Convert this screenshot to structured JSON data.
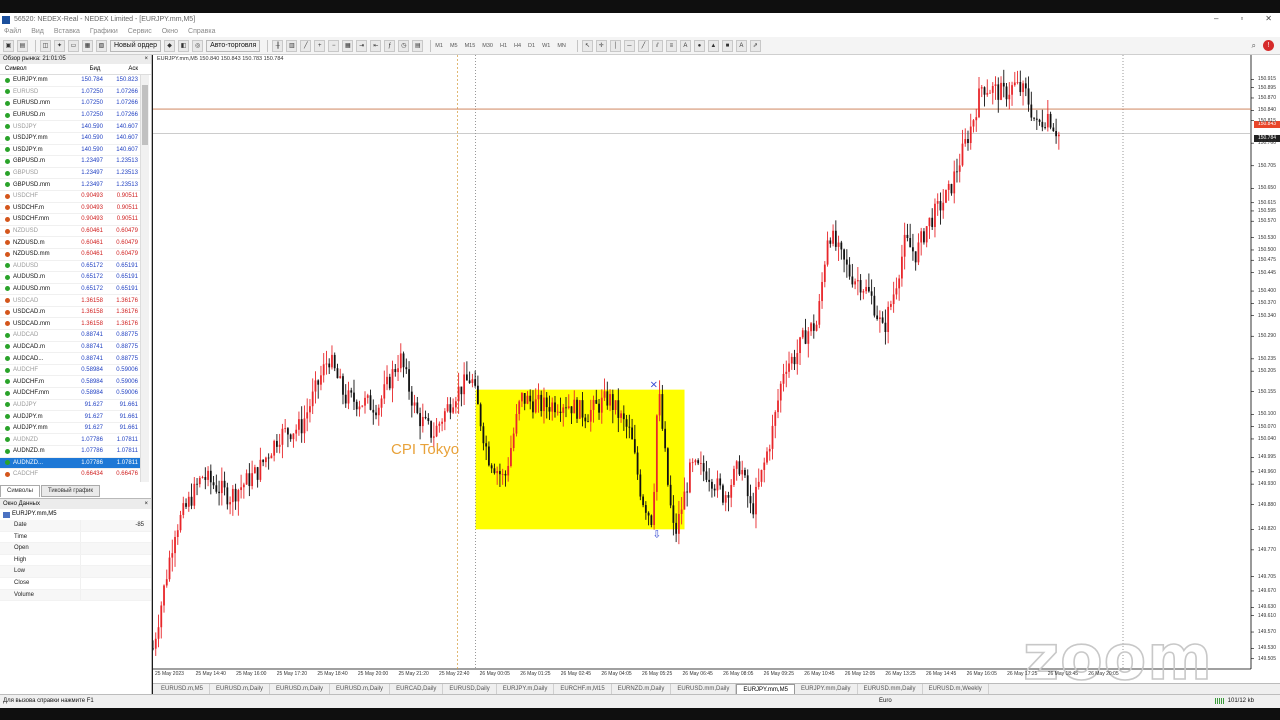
{
  "window": {
    "title": "56520: NEDEX-Real - NEDEX Limited - [EURJPY.mm,M5]",
    "controls": [
      "–",
      "▫",
      "✕"
    ]
  },
  "menu": {
    "items": [
      "Файл",
      "Вид",
      "Вставка",
      "Графики",
      "Сервис",
      "Окно",
      "Справка"
    ]
  },
  "toolbar": {
    "new_order": "Новый ордер",
    "auto_trading": "Авто-торговля",
    "timeframes": [
      "M1",
      "M5",
      "M15",
      "M30",
      "H1",
      "H4",
      "D1",
      "W1",
      "MN"
    ]
  },
  "market_watch": {
    "title": "Обзор рынка: 21:01:05",
    "col_symbol": "Символ",
    "col_bid": "Бид",
    "col_ask": "Аск",
    "rows": [
      {
        "sym": "EURJPY.mm",
        "bid": "150.784",
        "ask": "150.823",
        "dim": false,
        "red": false
      },
      {
        "sym": "EURUSD",
        "bid": "1.07250",
        "ask": "1.07266",
        "dim": true,
        "red": false
      },
      {
        "sym": "EURUSD.mm",
        "bid": "1.07250",
        "ask": "1.07266",
        "dim": false,
        "red": false
      },
      {
        "sym": "EURUSD.m",
        "bid": "1.07250",
        "ask": "1.07266",
        "dim": false,
        "red": false
      },
      {
        "sym": "USDJPY",
        "bid": "140.590",
        "ask": "140.607",
        "dim": true,
        "red": false
      },
      {
        "sym": "USDJPY.mm",
        "bid": "140.590",
        "ask": "140.607",
        "dim": false,
        "red": false
      },
      {
        "sym": "USDJPY.m",
        "bid": "140.590",
        "ask": "140.607",
        "dim": false,
        "red": false
      },
      {
        "sym": "GBPUSD.m",
        "bid": "1.23497",
        "ask": "1.23513",
        "dim": false,
        "red": false
      },
      {
        "sym": "GBPUSD",
        "bid": "1.23497",
        "ask": "1.23513",
        "dim": true,
        "red": false
      },
      {
        "sym": "GBPUSD.mm",
        "bid": "1.23497",
        "ask": "1.23513",
        "dim": false,
        "red": false
      },
      {
        "sym": "USDCHF",
        "bid": "0.90493",
        "ask": "0.90511",
        "dim": true,
        "red": true
      },
      {
        "sym": "USDCHF.m",
        "bid": "0.90493",
        "ask": "0.90511",
        "dim": false,
        "red": true
      },
      {
        "sym": "USDCHF.mm",
        "bid": "0.90493",
        "ask": "0.90511",
        "dim": false,
        "red": true
      },
      {
        "sym": "NZDUSD",
        "bid": "0.60461",
        "ask": "0.60479",
        "dim": true,
        "red": true
      },
      {
        "sym": "NZDUSD.m",
        "bid": "0.60461",
        "ask": "0.60479",
        "dim": false,
        "red": true
      },
      {
        "sym": "NZDUSD.mm",
        "bid": "0.60461",
        "ask": "0.60479",
        "dim": false,
        "red": true
      },
      {
        "sym": "AUDUSD",
        "bid": "0.65172",
        "ask": "0.65191",
        "dim": true,
        "red": false
      },
      {
        "sym": "AUDUSD.m",
        "bid": "0.65172",
        "ask": "0.65191",
        "dim": false,
        "red": false
      },
      {
        "sym": "AUDUSD.mm",
        "bid": "0.65172",
        "ask": "0.65191",
        "dim": false,
        "red": false
      },
      {
        "sym": "USDCAD",
        "bid": "1.36158",
        "ask": "1.36176",
        "dim": true,
        "red": true
      },
      {
        "sym": "USDCAD.m",
        "bid": "1.36158",
        "ask": "1.36176",
        "dim": false,
        "red": true
      },
      {
        "sym": "USDCAD.mm",
        "bid": "1.36158",
        "ask": "1.36176",
        "dim": false,
        "red": true
      },
      {
        "sym": "AUDCAD",
        "bid": "0.88741",
        "ask": "0.88775",
        "dim": true,
        "red": false
      },
      {
        "sym": "AUDCAD.m",
        "bid": "0.88741",
        "ask": "0.88775",
        "dim": false,
        "red": false
      },
      {
        "sym": "AUDCAD...",
        "bid": "0.88741",
        "ask": "0.88775",
        "dim": false,
        "red": false
      },
      {
        "sym": "AUDCHF",
        "bid": "0.58984",
        "ask": "0.59006",
        "dim": true,
        "red": false
      },
      {
        "sym": "AUDCHF.m",
        "bid": "0.58984",
        "ask": "0.59006",
        "dim": false,
        "red": false
      },
      {
        "sym": "AUDCHF.mm",
        "bid": "0.58984",
        "ask": "0.59006",
        "dim": false,
        "red": false
      },
      {
        "sym": "AUDJPY",
        "bid": "91.627",
        "ask": "91.661",
        "dim": true,
        "red": false
      },
      {
        "sym": "AUDJPY.m",
        "bid": "91.627",
        "ask": "91.661",
        "dim": false,
        "red": false
      },
      {
        "sym": "AUDJPY.mm",
        "bid": "91.627",
        "ask": "91.661",
        "dim": false,
        "red": false
      },
      {
        "sym": "AUDNZD",
        "bid": "1.07786",
        "ask": "1.07811",
        "dim": true,
        "red": false
      },
      {
        "sym": "AUDNZD.m",
        "bid": "1.07786",
        "ask": "1.07811",
        "dim": false,
        "red": false
      },
      {
        "sym": "AUDNZD...",
        "bid": "1.07786",
        "ask": "1.07811",
        "dim": false,
        "red": false,
        "selected": true
      },
      {
        "sym": "CADCHF",
        "bid": "0.66434",
        "ask": "0.66476",
        "dim": true,
        "red": true
      }
    ],
    "tabs": [
      "Символы",
      "Тиковый график"
    ]
  },
  "data_window": {
    "title": "Окно Данных",
    "symbol": "EURJPY.mm,M5",
    "rows": [
      {
        "label": "Date",
        "value": "-85"
      },
      {
        "label": "Time",
        "value": ""
      },
      {
        "label": "Open",
        "value": ""
      },
      {
        "label": "High",
        "value": ""
      },
      {
        "label": "Low",
        "value": ""
      },
      {
        "label": "Close",
        "value": ""
      },
      {
        "label": "Volume",
        "value": ""
      }
    ]
  },
  "chart": {
    "legend": "EURJPY.mm,M5  150.840 150.843 150.783 150.784",
    "annotation": "CPI Tokyo",
    "watermark": "zoom",
    "current_bid_tag": "150.843",
    "current_price_tag": "150.784",
    "colors": {
      "up": "#e8262a",
      "down": "#111111",
      "box": "#ffff00",
      "annotation": "#e8a23a"
    }
  },
  "chart_data": {
    "type": "candlestick",
    "title": "",
    "symbol": "EURJPY.mm",
    "timeframe": "M5",
    "y_ticks": [
      "150.915",
      "150.895",
      "150.870",
      "150.840",
      "150.815",
      "150.760",
      "150.705",
      "150.650",
      "150.615",
      "150.595",
      "150.570",
      "150.530",
      "150.500",
      "150.475",
      "150.445",
      "150.400",
      "150.370",
      "150.340",
      "150.290",
      "150.235",
      "150.205",
      "150.155",
      "150.100",
      "150.070",
      "150.040",
      "149.995",
      "149.960",
      "149.930",
      "149.880",
      "149.820",
      "149.770",
      "149.705",
      "149.670",
      "149.630",
      "149.610",
      "149.570",
      "149.530",
      "149.505"
    ],
    "x_ticks": [
      "25 May 2023",
      "25 May 14:40",
      "25 May 16:00",
      "25 May 17:20",
      "25 May 18:40",
      "25 May 20:00",
      "25 May 21:20",
      "25 May 22:40",
      "26 May 00:05",
      "26 May 01:25",
      "26 May 02:45",
      "26 May 04:05",
      "26 May 05:25",
      "26 May 06:45",
      "26 May 08:05",
      "26 May 09:25",
      "26 May 10:45",
      "26 May 12:05",
      "26 May 13:25",
      "26 May 14:45",
      "26 May 16:05",
      "26 May 17:25",
      "26 May 18:45",
      "26 May 20:05"
    ],
    "ylim": [
      149.48,
      150.96
    ],
    "path_points": [
      [
        0.0,
        149.53
      ],
      [
        0.02,
        149.82
      ],
      [
        0.045,
        149.95
      ],
      [
        0.07,
        149.9
      ],
      [
        0.095,
        149.96
      ],
      [
        0.115,
        150.05
      ],
      [
        0.135,
        150.07
      ],
      [
        0.16,
        150.24
      ],
      [
        0.175,
        150.14
      ],
      [
        0.205,
        150.12
      ],
      [
        0.225,
        150.24
      ],
      [
        0.24,
        150.1
      ],
      [
        0.255,
        150.05
      ],
      [
        0.275,
        150.15
      ],
      [
        0.29,
        150.19
      ],
      [
        0.305,
        150.0
      ],
      [
        0.32,
        149.94
      ],
      [
        0.335,
        150.14
      ],
      [
        0.355,
        150.12
      ],
      [
        0.375,
        150.13
      ],
      [
        0.395,
        150.1
      ],
      [
        0.415,
        150.14
      ],
      [
        0.435,
        150.05
      ],
      [
        0.445,
        149.9
      ],
      [
        0.455,
        149.84
      ],
      [
        0.46,
        150.17
      ],
      [
        0.47,
        149.9
      ],
      [
        0.475,
        149.8
      ],
      [
        0.49,
        149.97
      ],
      [
        0.505,
        149.96
      ],
      [
        0.52,
        149.9
      ],
      [
        0.535,
        149.98
      ],
      [
        0.545,
        149.86
      ],
      [
        0.555,
        149.96
      ],
      [
        0.565,
        150.07
      ],
      [
        0.575,
        150.22
      ],
      [
        0.585,
        150.24
      ],
      [
        0.595,
        150.3
      ],
      [
        0.605,
        150.32
      ],
      [
        0.615,
        150.55
      ],
      [
        0.625,
        150.49
      ],
      [
        0.635,
        150.44
      ],
      [
        0.645,
        150.42
      ],
      [
        0.655,
        150.38
      ],
      [
        0.665,
        150.3
      ],
      [
        0.675,
        150.4
      ],
      [
        0.685,
        150.52
      ],
      [
        0.695,
        150.49
      ],
      [
        0.705,
        150.56
      ],
      [
        0.715,
        150.6
      ],
      [
        0.725,
        150.64
      ],
      [
        0.735,
        150.72
      ],
      [
        0.745,
        150.8
      ],
      [
        0.755,
        150.9
      ],
      [
        0.765,
        150.89
      ],
      [
        0.775,
        150.88
      ],
      [
        0.785,
        150.9
      ],
      [
        0.795,
        150.88
      ],
      [
        0.805,
        150.8
      ],
      [
        0.815,
        150.83
      ],
      [
        0.825,
        150.78
      ]
    ],
    "highlight_box": {
      "x_start": "26 May 00:05",
      "x_end": "26 May 06:45",
      "y_high": 150.16,
      "y_low": 149.82
    },
    "current_price": 150.784,
    "ask_line": 150.843
  },
  "chart_tabs": [
    "EURUSD.m,M5",
    "EURUSD.m,Daily",
    "EURUSD.m,Daily",
    "EURUSD.m,Daily",
    "EURCAD,Daily",
    "EURUSD,Daily",
    "EURJPY.m,Daily",
    "EURCHF.m,M15",
    "EURNZD.m,Daily",
    "EURUSD.mm,Daily",
    "EURJPY.mm,M5",
    "EURJPY.mm,Daily",
    "EURUSD.mm,Daily",
    "EURUSD.m,Weekly"
  ],
  "active_chart_tab": 10,
  "status": {
    "help": "Для вызова справки нажмите F1",
    "profile": "Euro",
    "traffic": "101/12 kb"
  }
}
